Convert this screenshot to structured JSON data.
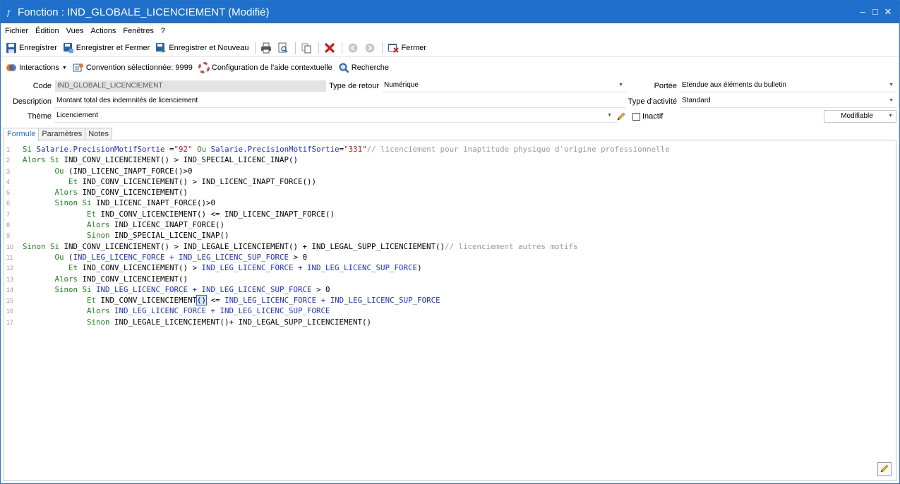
{
  "window": {
    "title": "Fonction : IND_GLOBALE_LICENCIEMENT (Modifié)",
    "controls": {
      "minimize": "–",
      "maximize": "□",
      "close": "✕"
    }
  },
  "menu": [
    "Fichier",
    "Édition",
    "Vues",
    "Actions",
    "Fenêtres",
    "?"
  ],
  "toolbar1": {
    "save": "Enregistrer",
    "save_close": "Enregistrer et Fermer",
    "save_new": "Enregistrer et Nouveau",
    "close": "Fermer"
  },
  "toolbar2": {
    "interactions": "Interactions",
    "convention": "Convention sélectionnée: 9999",
    "help_config": "Configuration de l'aide contextuelle",
    "search": "Recherche"
  },
  "form": {
    "code_label": "Code",
    "code_value": "IND_GLOBALE_LICENCIEMENT",
    "return_type_label": "Type de retour",
    "return_type_value": "Numérique",
    "scope_label": "Portée",
    "scope_value": "Etendue aux éléments du bulletin",
    "description_label": "Description",
    "description_value": "Montant total des indemnités de licenciement",
    "activity_type_label": "Type d'activité",
    "activity_type_value": "Standard",
    "theme_label": "Thème",
    "theme_value": "Licenciement",
    "inactive_label": "Inactif",
    "modifiable_value": "Modifiable"
  },
  "tabs": [
    "Formule",
    "Paramètres",
    "Notes"
  ],
  "colors": {
    "titlebar": "#1f6fcd",
    "keyword": "#1a8a1a",
    "identifier": "#1c2fcf",
    "string": "#c8161f",
    "comment": "#9a9a9a"
  },
  "code": {
    "lines": [
      [
        [
          "k",
          "Si "
        ],
        [
          "b",
          "Salarie.PrecisionMotifSortie"
        ],
        [
          "n",
          " ="
        ],
        [
          "s",
          "\"92\""
        ],
        [
          "k",
          " Ou "
        ],
        [
          "b",
          "Salarie.PrecisionMotifSortie"
        ],
        [
          "n",
          "="
        ],
        [
          "s",
          "\"331\""
        ],
        [
          "c",
          "// licenciement pour inaptitude physique d'origine professionnelle"
        ]
      ],
      [
        [
          "k",
          "Alors Si "
        ],
        [
          "n",
          "IND_CONV_LICENCIEMENT() > IND_SPECIAL_LICENC_INAP()"
        ]
      ],
      [
        [
          "n",
          "       "
        ],
        [
          "k",
          "Ou "
        ],
        [
          "n",
          "(IND_LICENC_INAPT_FORCE()>0"
        ]
      ],
      [
        [
          "n",
          "          "
        ],
        [
          "k",
          "Et "
        ],
        [
          "n",
          "IND_CONV_LICENCIEMENT() > IND_LICENC_INAPT_FORCE())"
        ]
      ],
      [
        [
          "n",
          "       "
        ],
        [
          "k",
          "Alors "
        ],
        [
          "n",
          "IND_CONV_LICENCIEMENT()"
        ]
      ],
      [
        [
          "n",
          "       "
        ],
        [
          "k",
          "Sinon Si "
        ],
        [
          "n",
          "IND_LICENC_INAPT_FORCE()>0"
        ]
      ],
      [
        [
          "n",
          "              "
        ],
        [
          "k",
          "Et "
        ],
        [
          "n",
          "IND_CONV_LICENCIEMENT() <= IND_LICENC_INAPT_FORCE()"
        ]
      ],
      [
        [
          "n",
          "              "
        ],
        [
          "k",
          "Alors "
        ],
        [
          "n",
          "IND_LICENC_INAPT_FORCE()"
        ]
      ],
      [
        [
          "n",
          "              "
        ],
        [
          "k",
          "Sinon "
        ],
        [
          "n",
          "IND_SPECIAL_LICENC_INAP()"
        ]
      ],
      [
        [
          "k",
          "Sinon Si "
        ],
        [
          "n",
          "IND_CONV_LICENCIEMENT() > IND_LEGALE_LICENCIEMENT() + IND_LEGAL_SUPP_LICENCIEMENT()"
        ],
        [
          "c",
          "// licenciement autres motifs"
        ]
      ],
      [
        [
          "n",
          "       "
        ],
        [
          "k",
          "Ou "
        ],
        [
          "n",
          "("
        ],
        [
          "b",
          "IND_LEG_LICENC_FORCE + IND_LEG_LICENC_SUP_FORCE"
        ],
        [
          "n",
          " > 0"
        ]
      ],
      [
        [
          "n",
          "          "
        ],
        [
          "k",
          "Et "
        ],
        [
          "n",
          "IND_CONV_LICENCIEMENT() > "
        ],
        [
          "b",
          "IND_LEG_LICENC_FORCE + IND_LEG_LICENC_SUP_FORCE"
        ],
        [
          "n",
          ")"
        ]
      ],
      [
        [
          "n",
          "       "
        ],
        [
          "k",
          "Alors "
        ],
        [
          "n",
          "IND_CONV_LICENCIEMENT()"
        ]
      ],
      [
        [
          "n",
          "       "
        ],
        [
          "k",
          "Sinon Si "
        ],
        [
          "b",
          "IND_LEG_LICENC_FORCE + IND_LEG_LICENC_SUP_FORCE"
        ],
        [
          "n",
          " > 0"
        ]
      ],
      [
        [
          "n",
          "              "
        ],
        [
          "k",
          "Et "
        ],
        [
          "n",
          "IND_CONV_LICENCIEMENT"
        ],
        [
          "m",
          "()"
        ],
        [
          "n",
          " <= "
        ],
        [
          "b",
          "IND_LEG_LICENC_FORCE + IND_LEG_LICENC_SUP_FORCE"
        ]
      ],
      [
        [
          "n",
          "              "
        ],
        [
          "k",
          "Alors "
        ],
        [
          "b",
          "IND_LEG_LICENC_FORCE + IND_LEG_LICENC_SUP_FORCE"
        ]
      ],
      [
        [
          "n",
          "              "
        ],
        [
          "k",
          "Sinon "
        ],
        [
          "n",
          "IND_LEGALE_LICENCIEMENT()+ IND_LEGAL_SUPP_LICENCIEMENT()"
        ]
      ]
    ]
  }
}
